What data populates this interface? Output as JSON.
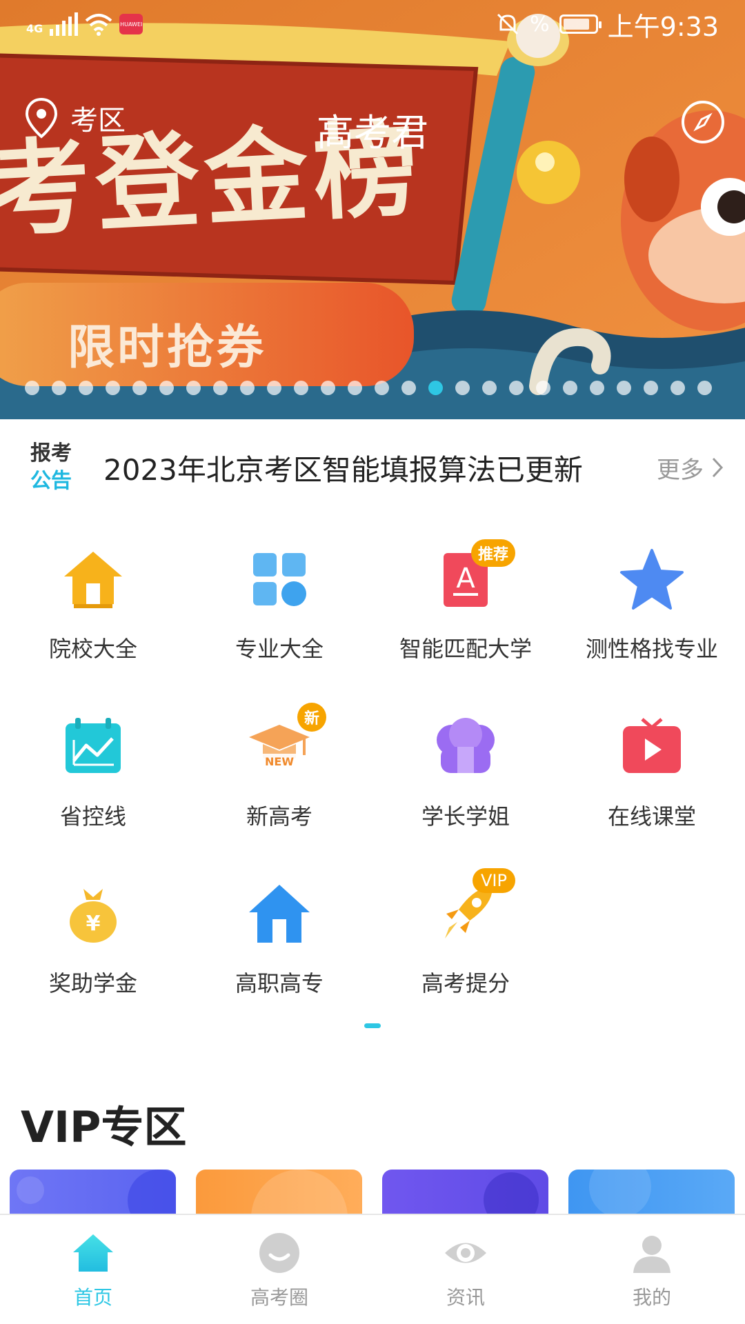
{
  "status_bar": {
    "network": "4G",
    "app_badge": "HUAWEI",
    "battery_level": 0.85,
    "time": "上午9:33"
  },
  "topbar": {
    "location_label": "考区",
    "title": "高考君",
    "compass_icon": "compass-icon"
  },
  "banner": {
    "headline": "考登金榜",
    "button_label": "限时抢券",
    "dot_count": 26,
    "active_dot": 15
  },
  "notice": {
    "tag_line1": "报考",
    "tag_line2": "公告",
    "text": "2023年北京考区智能填报算法已更新",
    "more_label": "更多"
  },
  "grid": {
    "items": [
      {
        "label": "院校大全",
        "icon": "school-house-icon",
        "tag": ""
      },
      {
        "label": "专业大全",
        "icon": "major-grid-icon",
        "tag": ""
      },
      {
        "label": "智能匹配大学",
        "icon": "smart-match-icon",
        "tag": "推荐"
      },
      {
        "label": "测性格找专业",
        "icon": "star-icon",
        "tag": ""
      },
      {
        "label": "省控线",
        "icon": "line-chart-icon",
        "tag": ""
      },
      {
        "label": "新高考",
        "icon": "graduation-cap-icon",
        "tag": "新",
        "sub": "NEW"
      },
      {
        "label": "学长学姐",
        "icon": "seniors-icon",
        "tag": ""
      },
      {
        "label": "在线课堂",
        "icon": "video-play-icon",
        "tag": ""
      },
      {
        "label": "奖助学金",
        "icon": "money-bag-icon",
        "tag": "",
        "sub": "¥"
      },
      {
        "label": "高职高专",
        "icon": "college-house-icon",
        "tag": ""
      },
      {
        "label": "高考提分",
        "icon": "rocket-icon",
        "tag": "VIP"
      }
    ]
  },
  "vip_section": {
    "title": "VIP专区"
  },
  "tabbar": {
    "tabs": [
      {
        "label": "首页",
        "icon": "home-icon",
        "active": true
      },
      {
        "label": "高考圈",
        "icon": "chat-bubble-icon",
        "active": false
      },
      {
        "label": "资讯",
        "icon": "eye-icon",
        "active": false
      },
      {
        "label": "我的",
        "icon": "user-icon",
        "active": false
      }
    ]
  },
  "colors": {
    "accent": "#2ec7e4",
    "banner_orange": "#e8802f",
    "banner_red": "#b8341f",
    "tag_yellow": "#f7a400"
  }
}
